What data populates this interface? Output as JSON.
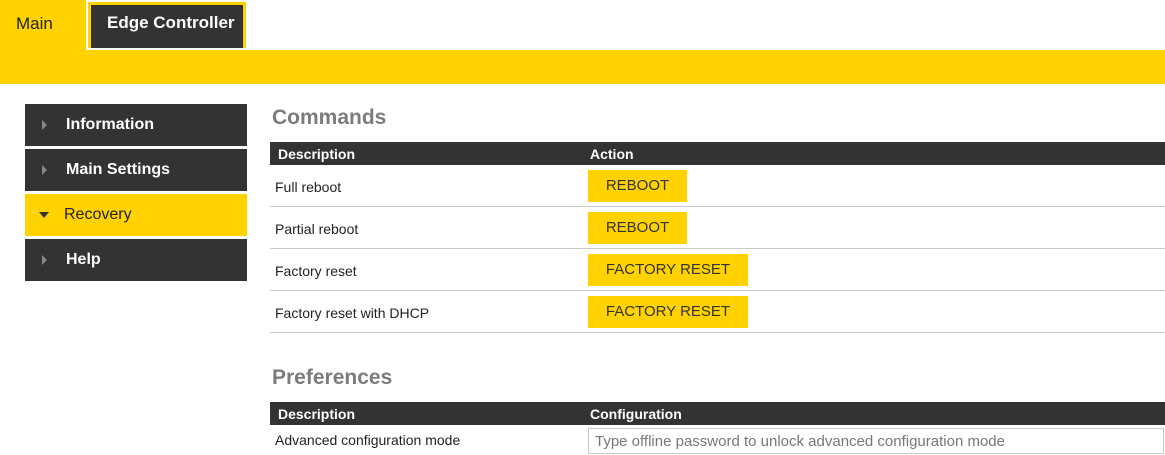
{
  "tabs": [
    {
      "label": "Main"
    },
    {
      "label": "Edge Controller"
    }
  ],
  "sidebar": {
    "items": [
      {
        "label": "Information"
      },
      {
        "label": "Main Settings"
      },
      {
        "label": "Recovery"
      },
      {
        "label": "Help"
      }
    ]
  },
  "commands": {
    "title": "Commands",
    "headers": {
      "description": "Description",
      "action": "Action"
    },
    "rows": [
      {
        "description": "Full reboot",
        "action": "REBOOT"
      },
      {
        "description": "Partial reboot",
        "action": "REBOOT"
      },
      {
        "description": "Factory reset",
        "action": "FACTORY RESET"
      },
      {
        "description": "Factory reset with DHCP",
        "action": "FACTORY RESET"
      }
    ]
  },
  "preferences": {
    "title": "Preferences",
    "headers": {
      "description": "Description",
      "configuration": "Configuration"
    },
    "rows": [
      {
        "description": "Advanced configuration mode",
        "placeholder": "Type offline password to unlock advanced configuration mode",
        "value": ""
      }
    ]
  },
  "colors": {
    "accent": "#ffd200",
    "dark": "#333333",
    "title_gray": "#7c7c7c"
  }
}
